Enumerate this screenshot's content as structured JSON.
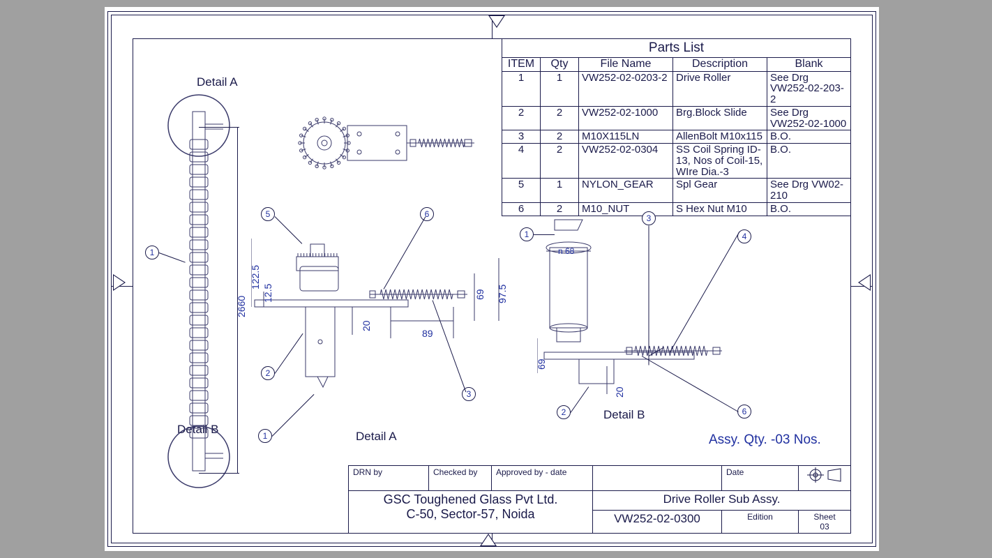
{
  "parts_list": {
    "title": "Parts List",
    "headers": {
      "item": "ITEM",
      "qty": "Qty",
      "file": "File Name",
      "desc": "Description",
      "blank": "Blank"
    },
    "rows": [
      {
        "item": "1",
        "qty": "1",
        "file": "VW252-02-0203-2",
        "desc": "Drive Roller",
        "blank": "See Drg VW252-02-203-2"
      },
      {
        "item": "2",
        "qty": "2",
        "file": "VW252-02-1000",
        "desc": "Brg.Block Slide",
        "blank": "See Drg VW252-02-1000"
      },
      {
        "item": "3",
        "qty": "2",
        "file": "M10X115LN",
        "desc": "AllenBolt M10x115",
        "blank": "B.O."
      },
      {
        "item": "4",
        "qty": "2",
        "file": "VW252-02-0304",
        "desc": "SS Coil Spring ID-13, Nos of Coil-15, WIre Dia.-3",
        "blank": "B.O."
      },
      {
        "item": "5",
        "qty": "1",
        "file": "NYLON_GEAR",
        "desc": "Spl Gear",
        "blank": "See Drg VW02-210"
      },
      {
        "item": "6",
        "qty": "2",
        "file": "M10_NUT",
        "desc": "S Hex Nut M10",
        "blank": "B.O."
      }
    ]
  },
  "labels": {
    "detail_a_top": "Detail A",
    "detail_b_left": "Detail B",
    "detail_a_mid": "Detail A",
    "detail_b_right": "Detail B"
  },
  "balloons_left": {
    "b1": "1"
  },
  "balloons_mid": {
    "b5": "5",
    "b6": "6",
    "b2": "2",
    "b3": "3",
    "b1": "1"
  },
  "balloons_right": {
    "b1": "1",
    "b3": "3",
    "b4": "4",
    "b2": "2",
    "b6": "6"
  },
  "dims": {
    "d2660": "2660",
    "d122_5": "122.5",
    "d12_5": "12.5",
    "d20a": "20",
    "d89": "89",
    "d69a": "69",
    "d97_5": "97.5",
    "n68": "n 68",
    "d69b": "69",
    "d20b": "20"
  },
  "assy_note": "Assy. Qty. -03 Nos.",
  "title_block": {
    "drn_by": "DRN by",
    "checked_by": "Checked by",
    "approved_by": "Approved by - date",
    "date": "Date",
    "company_line1": "GSC Toughened Glass Pvt Ltd.",
    "company_line2": "C-50, Sector-57, Noida",
    "title": "Drive Roller Sub Assy.",
    "drawing_no": "VW252-02-0300",
    "edition_label": "Edition",
    "edition": "",
    "sheet_label": "Sheet",
    "sheet": "03"
  }
}
